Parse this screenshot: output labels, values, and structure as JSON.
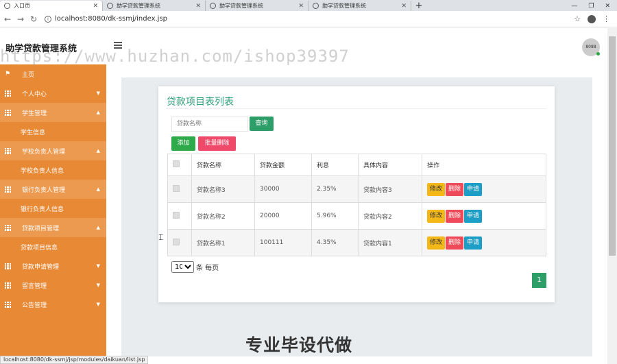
{
  "browser": {
    "tabs": [
      {
        "label": "入口页",
        "active": true
      },
      {
        "label": "助学贷款管理系统",
        "active": false
      },
      {
        "label": "助学贷款管理系统",
        "active": false
      },
      {
        "label": "助学贷款管理系统",
        "active": false
      }
    ],
    "url": "localhost:8080/dk-ssmj/index.jsp",
    "status_url": "localhost:8080/dk-ssmj/jsp/modules/daikuan/list.jsp"
  },
  "header": {
    "brand": "助学贷款管理系统",
    "avatar_text": "8088",
    "watermark": "https://www.huzhan.com/ishop39397"
  },
  "sidebar": {
    "items": [
      {
        "label": "主页",
        "icon": "flag-icon",
        "type": "top"
      },
      {
        "label": "个人中心",
        "icon": "grid-icon",
        "type": "menu",
        "caret": "down"
      },
      {
        "label": "学生管理",
        "icon": "grid-icon",
        "type": "menu",
        "caret": "up"
      },
      {
        "label": "学生信息",
        "type": "sub"
      },
      {
        "label": "学校负责人管理",
        "icon": "grid-icon",
        "type": "menu",
        "caret": "up"
      },
      {
        "label": "学校负责人信息",
        "type": "sub"
      },
      {
        "label": "银行负责人管理",
        "icon": "grid-icon",
        "type": "menu",
        "caret": "up"
      },
      {
        "label": "银行负责人信息",
        "type": "sub"
      },
      {
        "label": "贷款项目管理",
        "icon": "grid-icon",
        "type": "menu",
        "caret": "up"
      },
      {
        "label": "贷款项目信息",
        "type": "sub"
      },
      {
        "label": "贷款申请管理",
        "icon": "grid-icon",
        "type": "menu",
        "caret": "down"
      },
      {
        "label": "留言管理",
        "icon": "grid-icon",
        "type": "menu",
        "caret": "down"
      },
      {
        "label": "公告管理",
        "icon": "grid-icon",
        "type": "menu",
        "caret": "down"
      }
    ]
  },
  "main": {
    "title": "贷款项目表列表",
    "search_placeholder": "贷款名称",
    "query_label": "查询",
    "add_label": "添加",
    "batch_delete_label": "批量删除",
    "columns": [
      "贷款名称",
      "贷款金额",
      "利息",
      "具体内容",
      "操作"
    ],
    "rows": [
      {
        "name": "贷款名称3",
        "amount": "30000",
        "interest": "2.35%",
        "content": "贷款内容3"
      },
      {
        "name": "贷款名称2",
        "amount": "20000",
        "interest": "5.96%",
        "content": "贷款内容2"
      },
      {
        "name": "贷款名称1",
        "amount": "100111",
        "interest": "4.35%",
        "content": "贷款内容1"
      }
    ],
    "row_actions": {
      "edit": "修改",
      "delete": "删除",
      "apply": "申请"
    },
    "page_size": "10",
    "page_size_suffix": "条 每页",
    "current_page": "1"
  },
  "overlay_text": "专业毕设代做",
  "colors": {
    "sidebar": "#e88a35",
    "title_green": "#30a07c",
    "query_button": "#2e9e68",
    "add_button": "#2eaa4b",
    "batch_delete_button": "#ef4a6a"
  }
}
